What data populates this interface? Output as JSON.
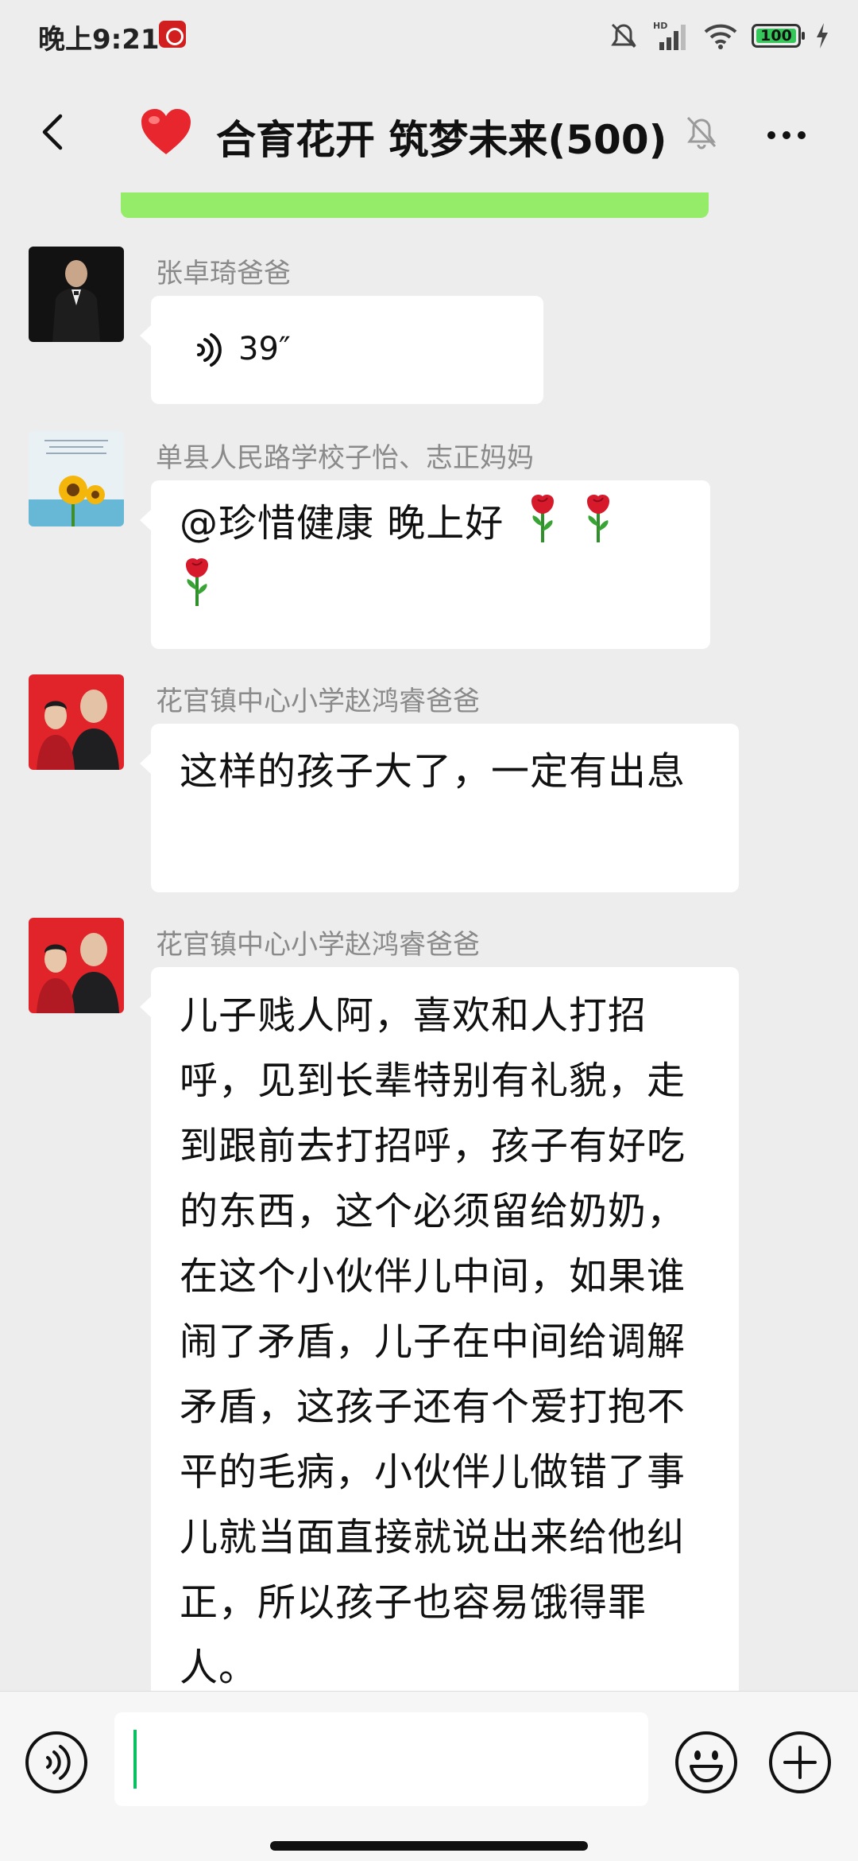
{
  "status_bar": {
    "time": "晚上9:21",
    "app_icon": "app-notification-icon",
    "icons": [
      "mute-icon",
      "hd-signal-icon",
      "wifi-icon",
      "battery-icon",
      "charging-icon"
    ],
    "signal_label": "HD",
    "battery_level": "100"
  },
  "header": {
    "back_icon": "back-arrow-icon",
    "emoji": "red-heart-icon",
    "title": "合育花开 筑梦未来(500)",
    "mute_icon": "bell-muted-icon",
    "more_icon": "more-options-icon"
  },
  "messages": [
    {
      "sender": "张卓琦爸爸",
      "type": "voice",
      "duration": "39″"
    },
    {
      "sender": "单县人民路学校子怡、志正妈妈",
      "type": "text",
      "text": "@珍惜健康  晚上好",
      "emoji": [
        "rose-icon",
        "rose-icon",
        "rose-icon"
      ]
    },
    {
      "sender": "花官镇中心小学赵鸿睿爸爸",
      "type": "text",
      "text": "这样的孩子大了，一定有出息"
    },
    {
      "sender": "花官镇中心小学赵鸿睿爸爸",
      "type": "text",
      "text": "儿子贱人阿，喜欢和人打招呼，见到长辈特别有礼貌，走到跟前去打招呼，孩子有好吃的东西，这个必须留给奶奶，在这个小伙伴儿中间，如果谁闹了矛盾，儿子在中间给调解矛盾，这孩子还有个爱打抱不平的毛病，小伙伴儿做错了事儿就当面直接就说出来给他纠正，所以孩子也容易饿得罪人。"
    }
  ],
  "input_bar": {
    "voice_icon": "voice-input-icon",
    "input_value": "",
    "emoji_icon": "emoji-icon",
    "plus_icon": "plus-icon"
  },
  "colors": {
    "background": "#ededed",
    "bubble": "#ffffff",
    "self_bubble": "#95ec69",
    "accent": "#07c160",
    "sender_name": "#8a8a8a"
  }
}
